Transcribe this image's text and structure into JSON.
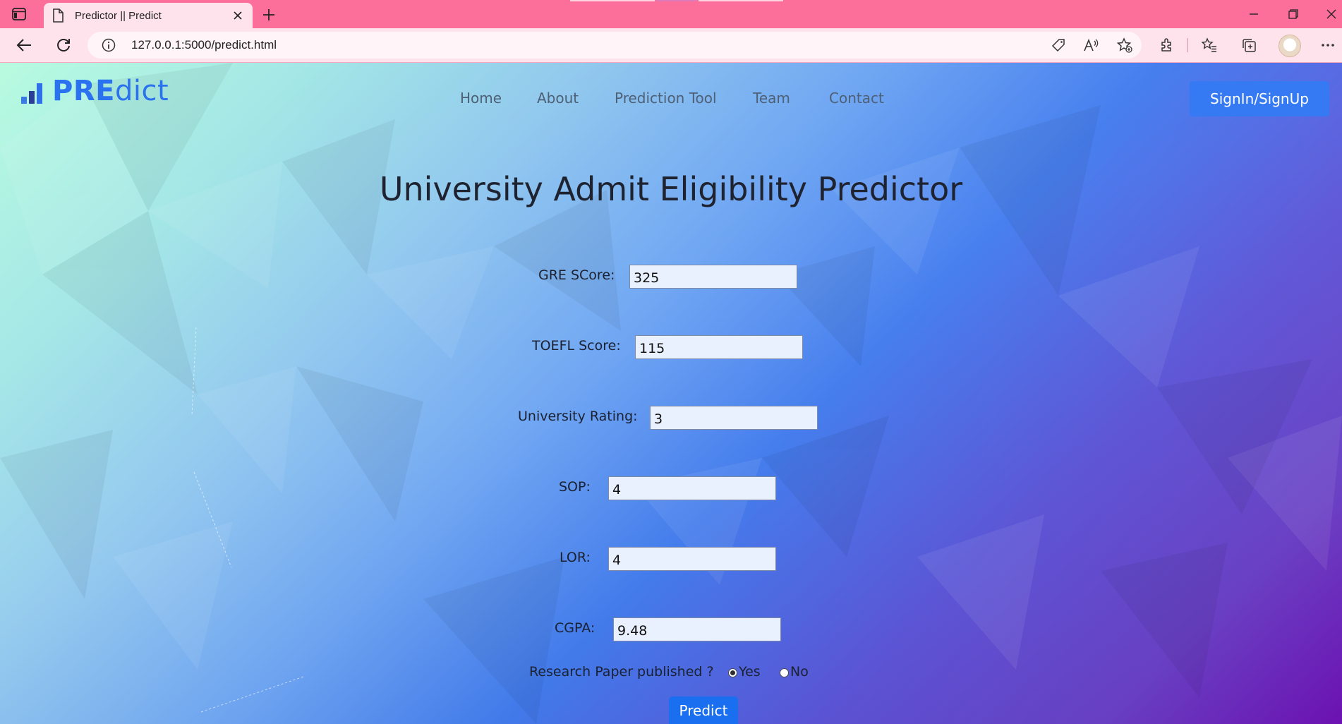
{
  "browser": {
    "tab_title": "Predictor || Predict",
    "url": "127.0.0.1:5000/predict.html"
  },
  "site": {
    "logo_bold": "PRE",
    "logo_light": "dict",
    "nav": [
      "Home",
      "About",
      "Prediction Tool",
      "Team",
      "Contact"
    ],
    "signin_label": "SignIn/SignUp",
    "brand_color": "#2a72ef"
  },
  "form": {
    "heading": "University Admit Eligibility Predictor",
    "fields": [
      {
        "label": "GRE SCore:",
        "value": "325"
      },
      {
        "label": "TOEFL Score:",
        "value": "115"
      },
      {
        "label": "University Rating:",
        "value": "3"
      },
      {
        "label": "SOP:",
        "value": "4"
      },
      {
        "label": "LOR:",
        "value": "4"
      },
      {
        "label": "CGPA:",
        "value": "9.48"
      }
    ],
    "research_question": "Research Paper published ?",
    "research_yes": "Yes",
    "research_no": "No",
    "research_selected": "Yes",
    "submit_label": "Predict"
  }
}
